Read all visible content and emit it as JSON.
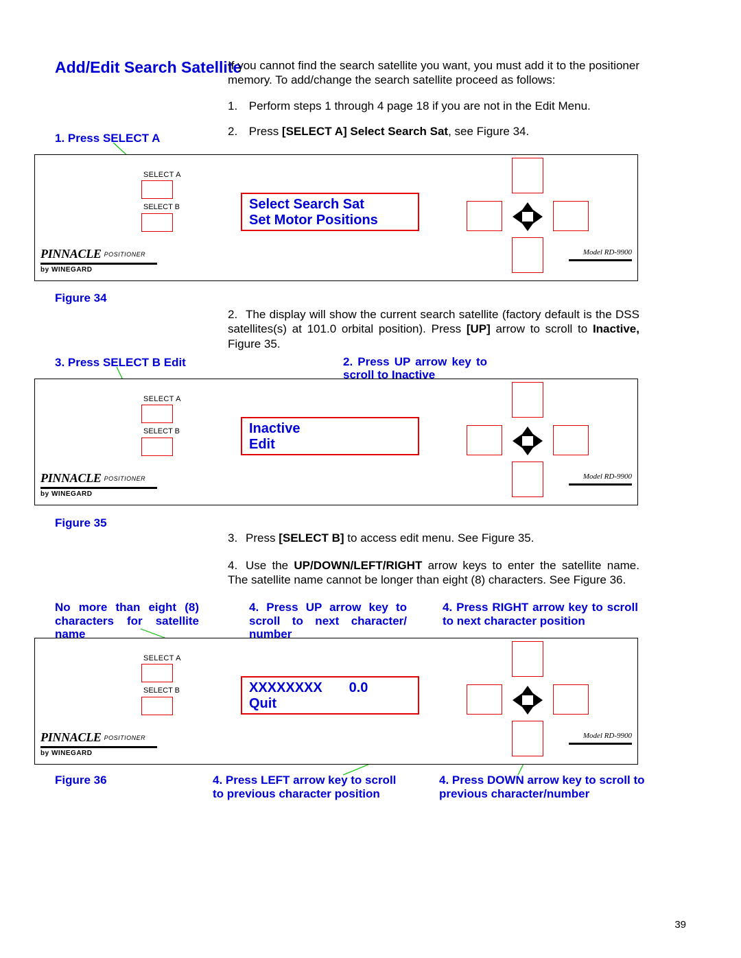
{
  "title": "Add/Edit Search Satellite",
  "intro": "If you cannot find the search satellite you want, you must add it to the positioner memory.  To add/change the search satellite proceed as follows:",
  "step1_num": "1.",
  "step1_text": "Perform steps 1 through 4 page 18 if you are not in the Edit Menu.",
  "step2a_num": "2.",
  "step2a_prefix": "Press ",
  "step2a_bold": "[SELECT A] Select Search Sat",
  "step2a_suffix": ", see Figure 34.",
  "label_press_a": "1. Press SELECT A",
  "panel": {
    "sel_a": "SELECT A",
    "sel_b": "SELECT B",
    "pinnacle": "PINNACLE",
    "positioner": "POSITIONER",
    "by": "by WINEGARD",
    "model": "Model RD-9900"
  },
  "lcd1_line1": "Select Search Sat",
  "lcd1_line2": "Set Motor Positions",
  "fig34": "Figure 34",
  "body2_num": "2.",
  "body2_a": "The display will show the current search satellite (factory default is the DSS satellites(s) at 101.0 orbital position).  Press ",
  "body2_b": "[UP]",
  "body2_c": " arrow to scroll to ",
  "body2_d": "Inactive,",
  "body2_e": " Figure 35.",
  "label_select_b_edit": "3. Press SELECT B Edit",
  "label_up_inactive": "2. Press UP arrow key to scroll to Inactive",
  "lcd2_line1": "Inactive",
  "lcd2_line2": "Edit",
  "fig35": "Figure 35",
  "body3_num": "3.",
  "body3_a": "Press ",
  "body3_b": "[SELECT B]",
  "body3_c": " to access edit menu.  See Figure 35.",
  "body4_num": "4.",
  "body4_a": "Use the ",
  "body4_b": "UP/DOWN/LEFT/RIGHT",
  "body4_c": " arrow keys to enter the satellite name.  The satellite name cannot be longer than eight (8) characters.  See Figure 36.",
  "label_eight": "No more than eight (8) characters for satellite name",
  "label_up_char": "4. Press UP arrow key to scroll to next character/ number",
  "label_right_pos": "4. Press RIGHT arrow key to scroll to next character position",
  "lcd3_line1": "XXXXXXXX       0.0",
  "lcd3_line2": "Quit",
  "fig36": "Figure 36",
  "label_left_pos": "4. Press LEFT arrow key to scroll to previous character position",
  "label_down_char": "4. Press DOWN arrow key to scroll to previous character/number",
  "pagenum": "39"
}
